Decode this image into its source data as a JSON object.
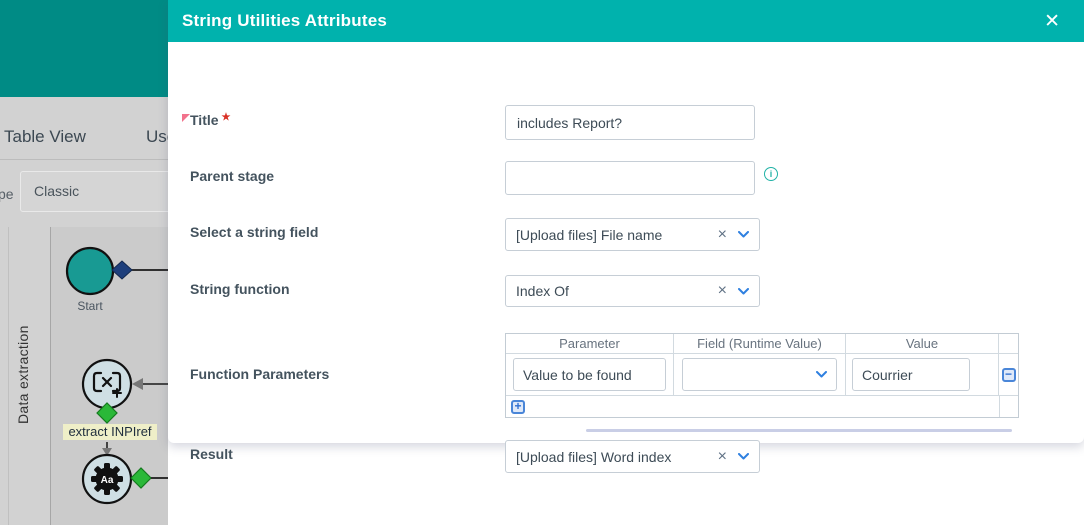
{
  "colors": {
    "app_header_teal": "#008B85",
    "modal_header_teal": "#00B2AD",
    "canvas_gray": "#CBCBCB",
    "start_node_teal": "#189A93",
    "task_node_fill": "#CFDFE4",
    "gateway_green": "#2AB838",
    "sequence_diamond_navy": "#1E3F7C",
    "label_highlight_yellow": "#EFEFC8",
    "accent_blue": "#2F80E0",
    "info_teal": "#21B2A6",
    "required_red": "#D93025"
  },
  "icons": {
    "close": "✕",
    "clear": "×",
    "info": "i",
    "minus": "−",
    "plus": "+",
    "required": "★"
  },
  "app": {
    "tabs": [
      {
        "label": "Table View"
      },
      {
        "label": "Use"
      }
    ],
    "type_label_fragment": "pe",
    "type_value": "Classic",
    "lane_label": "Data extraction",
    "diagram": {
      "start_label": "Start",
      "task1_label": "extract INPIref",
      "task2_icon_text": "Aa"
    }
  },
  "modal": {
    "title": "String Utilities Attributes",
    "fields": {
      "title": {
        "label": "Title",
        "value": "includes Report?"
      },
      "parent_stage": {
        "label": "Parent stage",
        "value": ""
      },
      "string_field": {
        "label": "Select a string field",
        "value": "[Upload files] File name"
      },
      "string_function": {
        "label": "String function",
        "value": "Index Of"
      },
      "function_parameters": {
        "label": "Function Parameters"
      },
      "result": {
        "label": "Result",
        "value": "[Upload files] Word index"
      }
    },
    "parameters_table": {
      "columns": [
        "Parameter",
        "Field (Runtime Value)",
        "Value"
      ],
      "rows": [
        {
          "parameter": "Value to be found",
          "field": "",
          "value": "Courrier"
        }
      ]
    }
  }
}
